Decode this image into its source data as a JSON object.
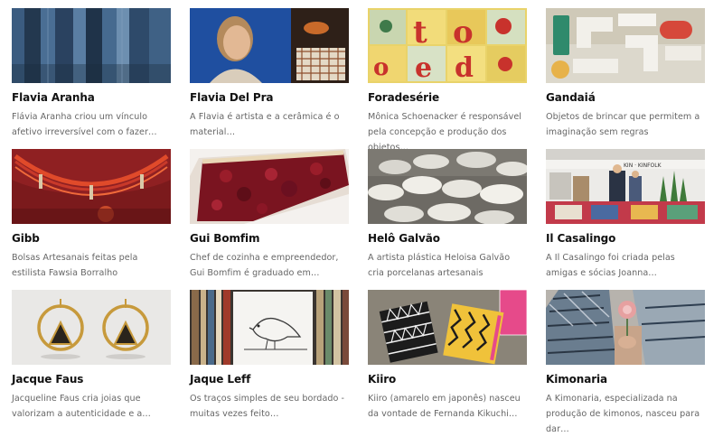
{
  "brands": [
    {
      "title": "Flavia Aranha",
      "desc": "Flávia Aranha criou um vínculo afetivo irreversível com o fazer…",
      "image": "indigo-garments-photo"
    },
    {
      "title": "Flavia Del Pra",
      "desc": "A Flavia é artista e a cerâmica é o material…",
      "image": "artist-portrait-photo"
    },
    {
      "title": "Foradesérie",
      "desc": "Mônica Schoenacker é responsável pela concepção e produção dos objetos…",
      "image": "letter-tiles-photo"
    },
    {
      "title": "Gandaiá",
      "desc": "Objetos de brincar que permitem a imaginação sem regras",
      "image": "wooden-toys-photo"
    },
    {
      "title": "Gibb",
      "desc": "Bolsas Artesanais feitas pela estilista Fawsia Borralho",
      "image": "red-bag-photo"
    },
    {
      "title": "Gui Bomfim",
      "desc": "Chef de cozinha e empreendedor, Gui Bomfim é graduado em…",
      "image": "berry-tart-photo"
    },
    {
      "title": "Helô Galvão",
      "desc": "A artista plástica Heloisa Galvão cria porcelanas artesanais",
      "image": "porcelain-bowls-photo"
    },
    {
      "title": "Il Casalingo",
      "desc": "A Il Casalingo foi criada pelas amigas e sócias Joanna…",
      "image": "market-stall-photo"
    },
    {
      "title": "Jacque Faus",
      "desc": "Jacqueline Faus cria joias que valorizam a autenticidade e a…",
      "image": "gold-earrings-photo"
    },
    {
      "title": "Jaque Leff",
      "desc": "Os traços simples de seu bordado - muitas vezes feito…",
      "image": "embroidered-bird-photo"
    },
    {
      "title": "Kiiro",
      "desc": "Kiiro (amarelo em japonês) nasceu da vontade de Fernanda Kikuchi…",
      "image": "patterned-cases-photo"
    },
    {
      "title": "Kimonaria",
      "desc": "A Kimonaria, especializada na produção de kimonos, nasceu para dar…",
      "image": "kimono-flower-photo"
    }
  ]
}
